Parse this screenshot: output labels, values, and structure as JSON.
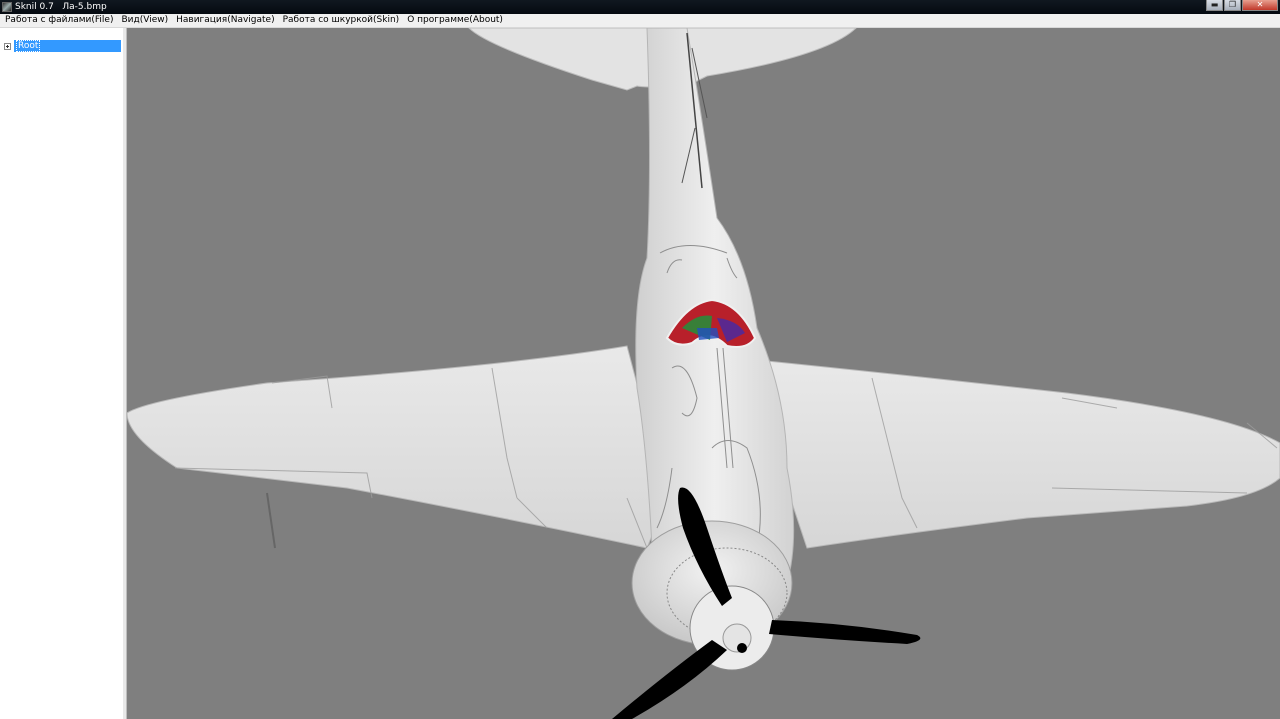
{
  "window": {
    "title": "Sknil 0.7   Ла-5.bmp",
    "buttons": {
      "minimize": "▬",
      "maximize": "❐",
      "close": "✕"
    }
  },
  "menu": {
    "items": [
      "Работа с файлами(File)",
      "Вид(View)",
      "Навигация(Navigate)",
      "Работа со шкуркой(Skin)",
      "О программе(About)"
    ]
  },
  "tree": {
    "root_label": "Root",
    "expanded": false,
    "selected": true
  },
  "viewport": {
    "content": "3d-aircraft-model",
    "background_color": "#7f7f7f",
    "model_color": "#e6e6e6",
    "propeller_color": "#000000"
  }
}
